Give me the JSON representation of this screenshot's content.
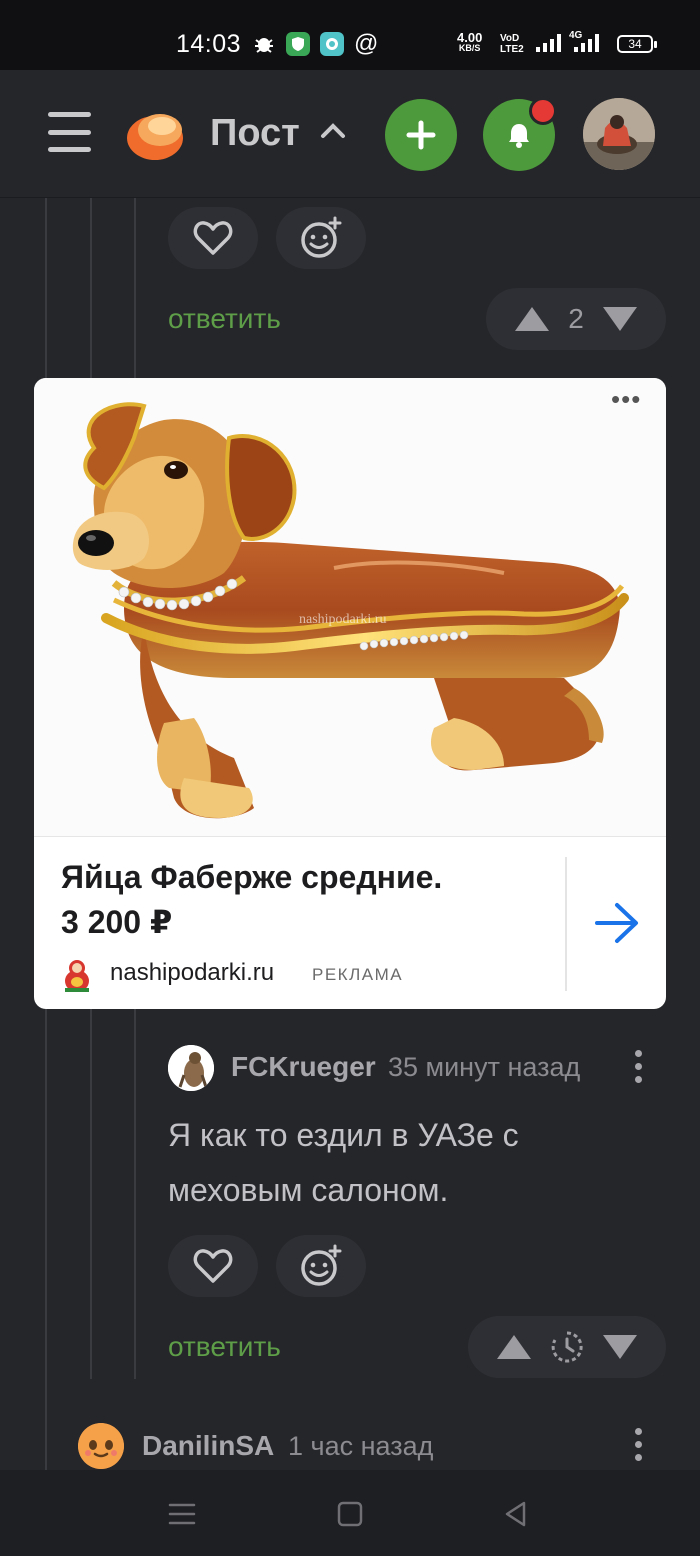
{
  "status_bar": {
    "time": "14:03",
    "net_speed_value": "4.00",
    "net_speed_unit": "KB/S",
    "volte": "VoD LTE2",
    "network": "4G",
    "battery": "34"
  },
  "header": {
    "title": "Пост",
    "icons": [
      "menu-icon",
      "logo",
      "chevron-up-icon",
      "plus-icon",
      "bell-icon",
      "avatar"
    ],
    "accent_color": "#4d9a3c",
    "notification_dot_color": "#e53935"
  },
  "comment_top": {
    "reply_label": "ответить",
    "vote_count": "2"
  },
  "ad": {
    "image_watermark": "nashipodarki.ru",
    "title": "Яйца Фаберже средние.",
    "price": "3 200 ₽",
    "domain": "nashipodarki.ru",
    "label": "РЕКЛАМА",
    "more": "•••",
    "arrow_color": "#1a73e8"
  },
  "comment_fck": {
    "username": "FCKrueger",
    "time": "35 минут назад",
    "text": "Я как то ездил в УАЗе с меховым салоном.",
    "reply_label": "ответить"
  },
  "comment_danilin": {
    "username": "DanilinSA",
    "time": "1 час назад"
  },
  "nav_bar": {
    "buttons": [
      "recent-apps-icon",
      "home-icon",
      "back-icon"
    ]
  }
}
